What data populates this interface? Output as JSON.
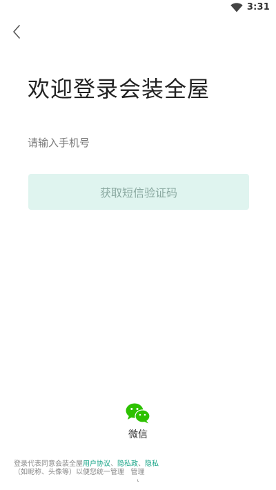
{
  "status_bar": {
    "time": "3:31",
    "wifi_icon": "wifi-icon"
  },
  "nav": {
    "back_icon": "chevron-left-icon"
  },
  "login": {
    "welcome_title": "欢迎登录会装全屋",
    "phone_placeholder": "请输入手机号",
    "sms_button_label": "获取短信验证码"
  },
  "third_party": {
    "wechat_icon": "wechat-icon",
    "wechat_label": "微信"
  },
  "agreement": {
    "prefix": "登录代表同意会装全屋",
    "user_agreement": "用户协议",
    "sep1": "、",
    "privacy_policy": "隐私政",
    "sep2": "、",
    "privacy_short": "隐私",
    "line2": "（如昵称、头像等）以便您统一管理",
    "line2_tail": "管理"
  },
  "colors": {
    "accent": "#19a588",
    "button_bg": "#dff4ef",
    "button_text": "#8aa8a0",
    "wechat_green": "#2dc100",
    "title_text": "#222222"
  }
}
